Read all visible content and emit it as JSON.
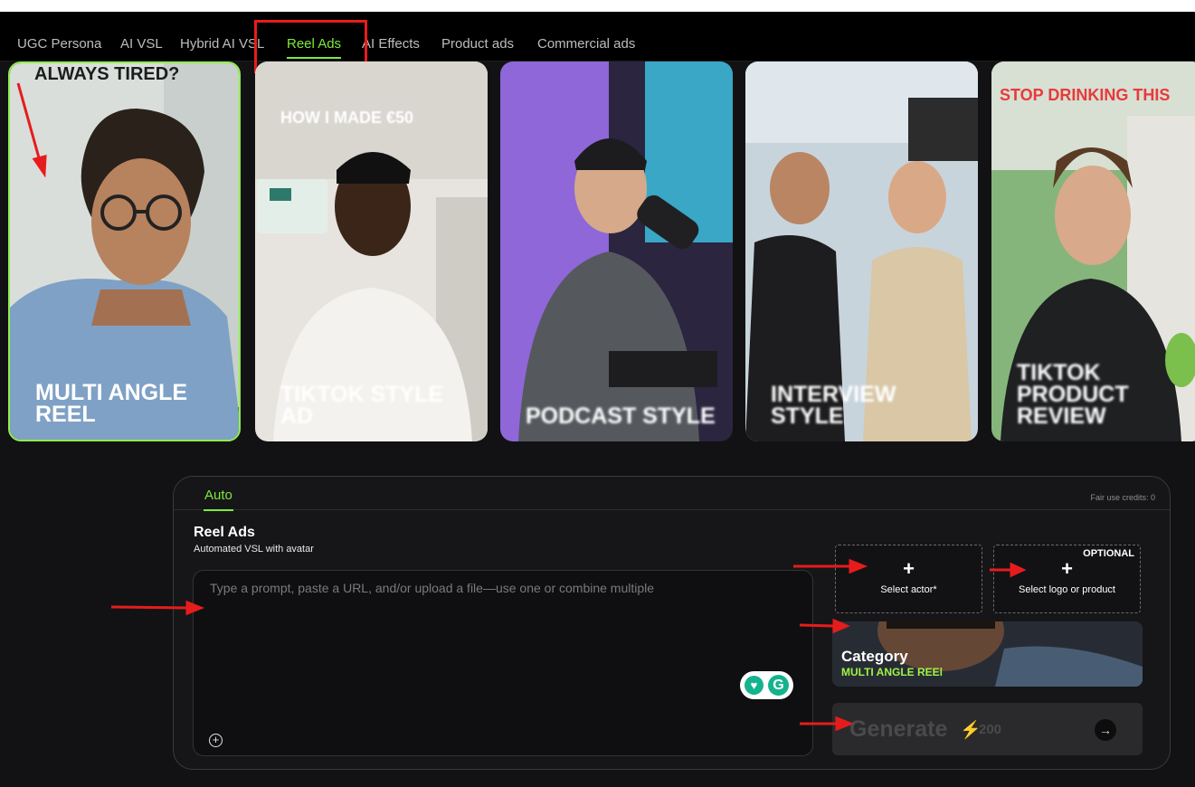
{
  "tabs": [
    {
      "label": "UGC Persona",
      "active": false
    },
    {
      "label": "AI VSL",
      "active": false
    },
    {
      "label": "Hybrid AI VSL",
      "active": false
    },
    {
      "label": "Reel Ads",
      "active": true
    },
    {
      "label": "AI Effects",
      "active": false
    },
    {
      "label": "Product ads",
      "active": false
    },
    {
      "label": "Commercial ads",
      "active": false
    }
  ],
  "cards": [
    {
      "title": "MULTI ANGLE REEl",
      "top_text": "ALWAYS TIRED?",
      "selected": true
    },
    {
      "title": "TIKTOK STYLE AD",
      "top_text": "HOW I MADE €50",
      "selected": false
    },
    {
      "title": "PODCAST STYLE",
      "top_text": "",
      "selected": false
    },
    {
      "title": "INTERVIEW STYLE",
      "top_text": "",
      "selected": false
    },
    {
      "title": "TIKTOK PRODUCT REVIEW",
      "top_text": "STOP DRINKING THIS",
      "selected": false
    }
  ],
  "panel": {
    "tab": "Auto",
    "fair_use": "Fair use credits: 0",
    "title": "Reel Ads",
    "subtitle": "Automated VSL with avatar",
    "prompt_placeholder": "Type a prompt, paste a URL, and/or upload a file—use one or combine multiple",
    "select_actor": "Select actor*",
    "select_logo": "Select logo or product",
    "optional": "OPTIONAL",
    "category_label": "Category",
    "category_value": "MULTI ANGLE REEl",
    "generate": "Generate",
    "cost": "200"
  },
  "colors": {
    "accent": "#7dea3c",
    "annotation": "#ea1b1b",
    "background": "#121214"
  },
  "icons": [
    "plus-icon",
    "attach-icon",
    "grammarly-icon",
    "bolt-icon",
    "arrow-right-icon"
  ]
}
